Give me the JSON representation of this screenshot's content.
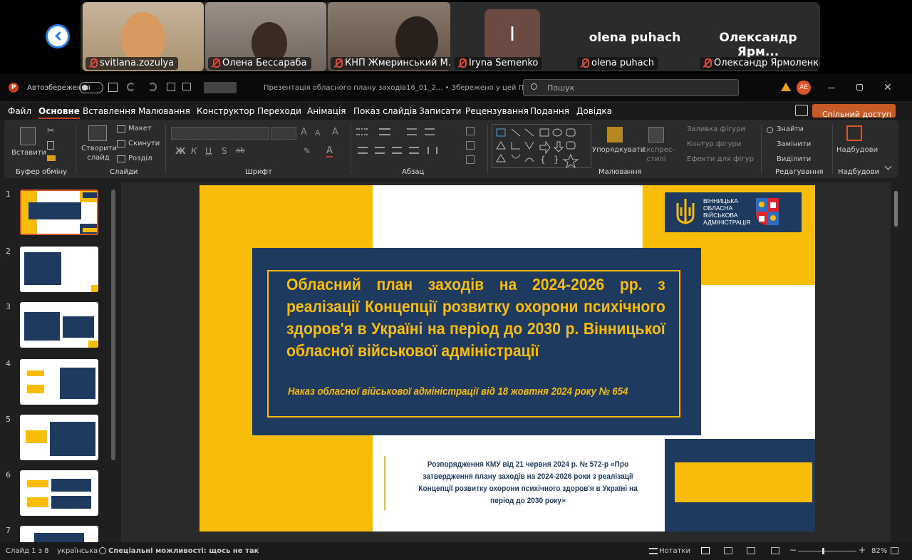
{
  "participants": [
    {
      "name": "svitlana.zozulya",
      "bg": "#b9a58c"
    },
    {
      "name": "Олена Бессараба",
      "bg": "#8a7e74"
    },
    {
      "name": "КНП Жмеринський М...",
      "bg": "#7a6a5d"
    },
    {
      "name": "Iryna Semenko",
      "initial": "I",
      "bg": "#6a4a42"
    },
    {
      "name": "olena puhach",
      "display": "olena puhach"
    },
    {
      "name": "Олександр Ярмоленко",
      "display": "Олександр  Ярм..."
    }
  ],
  "titlebar": {
    "autosave": "Автозбереження",
    "doc_title": "Презентація обласного плану заходів16_01_2... • Збережено у цей ПК",
    "search": "Пошук",
    "user_initials": "AE"
  },
  "menu": [
    "Файл",
    "Основне",
    "Вставлення",
    "Малювання",
    "Конструктор",
    "Переходи",
    "Анімація",
    "Показ слайдів",
    "Записати",
    "Рецензування",
    "Подання",
    "Довідка"
  ],
  "share_button": "Спільний доступ",
  "ribbon": {
    "paste": "Вставити",
    "clipboard": "Буфер обміну",
    "new_slide": "Створити слайд",
    "layout": "Макет",
    "reset": "Скинути",
    "section": "Розділ",
    "slides": "Слайди",
    "font": "Шрифт",
    "paragraph": "Абзац",
    "arrange": "Упорядкувати",
    "quick_styles": "Експрес-стилі",
    "drawing": "Малювання",
    "shape_fill": "Заливка фігури",
    "shape_outline": "Контур фігури",
    "shape_effects": "Ефекти для фігур",
    "find": "Знайти",
    "replace": "Замінити",
    "select": "Виділити",
    "editing": "Редагування",
    "addins": "Надбудови",
    "addins_group": "Надбудови",
    "font_buttons": [
      "Ж",
      "К",
      "Ц",
      "S",
      "ab"
    ]
  },
  "thumb_numbers": [
    "1",
    "2",
    "3",
    "4",
    "5",
    "6",
    "7"
  ],
  "slide": {
    "logo_line1": "ВІННИЦЬКА",
    "logo_line2": "ОБЛАСНА",
    "logo_line3": "ВІЙСЬКОВА",
    "logo_line4": "АДМІНІСТРАЦІЯ",
    "title": "Обласний план заходів на 2024-2026 рр. з реалізації Концепції розвитку охорони психічного здоров'я в Україні на період до 2030 р. Вінницької обласної військової адміністрації",
    "subtitle": "Наказ обласної військової адміністрації від 18 жовтня 2024 року № 654",
    "footnote": "Розпорядження КМУ від 21 червня 2024 р. № 572-р «Про затвердження плану заходів на 2024-2026 роки з реалізації Концепції розвитку охорони психічного здоров'я в Україні на період до 2030 року»",
    "colors": {
      "navy": "#1f3a5f",
      "yellow": "#f7bd0a"
    }
  },
  "status": {
    "slide_of": "Слайд 1 з 8",
    "language": "українська",
    "accessibility": "Спеціальні можливості: щось не так",
    "notes": "Нотатки",
    "zoom": "82%"
  }
}
